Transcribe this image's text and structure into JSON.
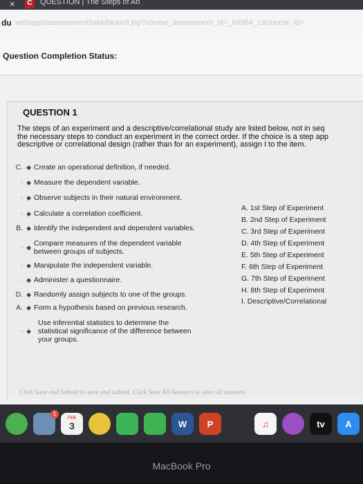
{
  "browser": {
    "tab_close": "×",
    "tab_favicon": "C",
    "tab_title": "QUESTION | The Steps of An",
    "url_domain": "du",
    "url_path": "webapps/assessment/take/launch.jsp?course_assessment_id=_64964_1&course_id="
  },
  "status": {
    "label": "Question Completion Status:"
  },
  "question": {
    "heading": "QUESTION 1",
    "instructions": [
      "The steps of an experiment and a descriptive/correlational study are listed below, not in seq",
      "the necessary steps to conduct an experiment in the correct order. If the choice is a step app",
      "descriptive or correlational design (rather than for an experiment), assign I to the item."
    ],
    "items": [
      {
        "selected": "C.",
        "text": "Create an operational definition, if needed."
      },
      {
        "selected": "-",
        "text": "Measure the dependent variable."
      },
      {
        "selected": "-",
        "text": "Observe subjects in their natural environment."
      },
      {
        "selected": "-",
        "text": "Calculate a correlation coefficient."
      },
      {
        "selected": "B.",
        "text": "Identify the independent and dependent variables."
      },
      {
        "selected": "-",
        "text": "Compare measures of the dependent variable",
        "text2": "between groups of subjects."
      },
      {
        "selected": "-",
        "text": "Manipulate the independent variable."
      },
      {
        "selected": "-",
        "text": "Administer a questionnaire."
      },
      {
        "selected": "D.",
        "text": "Randomly assign subjects to one of the groups."
      },
      {
        "selected": "A.",
        "text": "Form a hypothesis based on previous research."
      },
      {
        "selected": "-",
        "text": "Use inferential statistics to determine the",
        "text2": "statistical significance of the difference between",
        "text3": "your groups."
      }
    ],
    "choices": [
      "A. 1st Step of Experiment",
      "B. 2nd Step of Experiment",
      "C. 3rd Step of Experiment",
      "D. 4th Step of Experiment",
      "E. 5th Step of Experiment",
      "F. 6th Step of Experiment",
      "G. 7th Step of Experiment",
      "H. 8th Step of Experiment",
      "I. Descriptive/Correlational"
    ],
    "footer_note": "Click Save and Submit to save and submit. Click Save All Answers to save all answers."
  },
  "dock": {
    "icons": [
      {
        "name": "chrome",
        "color": "#4caf50",
        "label": ""
      },
      {
        "name": "preview",
        "color": "#6b8fb5",
        "label": ""
      },
      {
        "name": "calendar",
        "color": "#f2f2f2",
        "label": "3"
      },
      {
        "name": "photos",
        "color": "#e8c23a",
        "label": ""
      },
      {
        "name": "facetime",
        "color": "#3cb55a",
        "label": ""
      },
      {
        "name": "messages",
        "color": "#3fb34f",
        "label": ""
      },
      {
        "name": "word",
        "color": "#2b5797",
        "label": "W"
      },
      {
        "name": "powerpoint",
        "color": "#d04423",
        "label": "P"
      },
      {
        "name": "music",
        "color": "#f5f5f5",
        "label": "♫"
      },
      {
        "name": "podcasts",
        "color": "#9b4fc2",
        "label": ""
      },
      {
        "name": "apple-tv",
        "color": "#111111",
        "label": "tv"
      },
      {
        "name": "app-store",
        "color": "#2f8cf0",
        "label": "A"
      }
    ],
    "calendar_month": "FEB",
    "badge": "1"
  },
  "device": {
    "label": "MacBook Pro"
  }
}
